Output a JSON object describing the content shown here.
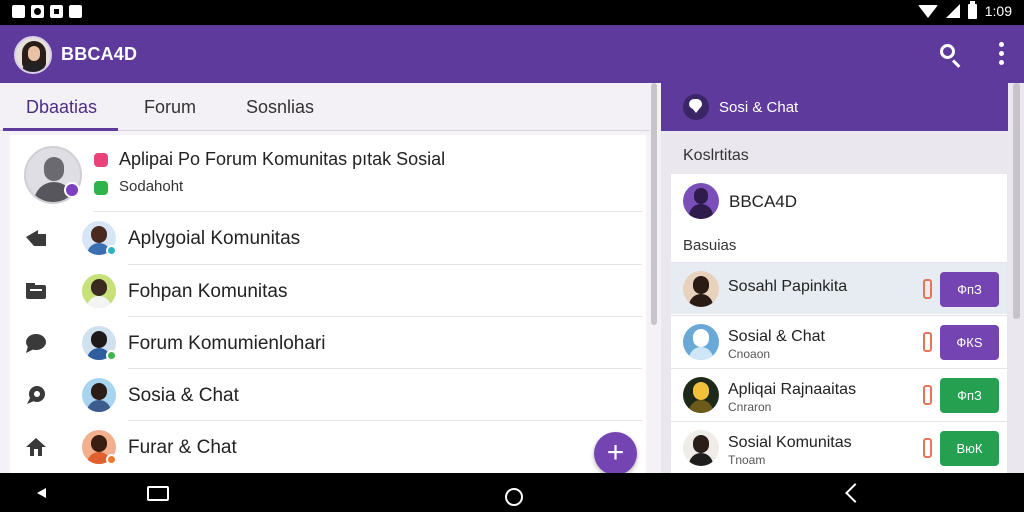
{
  "status_bar": {
    "time": "1:09"
  },
  "app_bar": {
    "title": "BBCA4D"
  },
  "tabs": [
    {
      "label": "Dbaatias",
      "active": true
    },
    {
      "label": "Forum",
      "active": false
    },
    {
      "label": "Sosnlias",
      "active": false
    }
  ],
  "main_list": {
    "top_item": {
      "title": "Aplipai Po Forum Komunitas pıtak Sosial",
      "subtitle": "Sodahoht"
    },
    "rows": [
      {
        "label": "Aplygoial Komunitas",
        "icon": "share-icon",
        "avatar_color": "#3b6fb0",
        "badge_color": "#2bb3c4"
      },
      {
        "label": "Fohpan Komunitas",
        "icon": "folder-icon",
        "avatar_color": "#9bc53d",
        "badge_color": ""
      },
      {
        "label": "Forum Komumienlohari",
        "icon": "chat-bubble-icon",
        "avatar_color": "#2f5d9e",
        "badge_color": "#3fb34f"
      },
      {
        "label": "Sosia & Chat",
        "icon": "comment-icon",
        "avatar_color": "#6fb0d8",
        "badge_color": ""
      },
      {
        "label": "Furar & Chat",
        "icon": "home-icon",
        "avatar_color": "#e0602f",
        "badge_color": "#ef7a2b"
      }
    ]
  },
  "right_panel": {
    "header_title": "Sosi & Chat",
    "section_label": "Koslrtitas",
    "user_name": "BBCA4D",
    "subsection_label": "Basuias",
    "rows": [
      {
        "name": "Sosahl Papinkita",
        "sub": "",
        "button": "ФпЗ",
        "button_color": "#7444b3",
        "avatar_color": "#e9d2bd",
        "selected": true
      },
      {
        "name": "Sosial & Chat",
        "sub": "Cnoaon",
        "button": "ФКЅ",
        "button_color": "#7444b3",
        "avatar_color": "#6aa8d6",
        "selected": false
      },
      {
        "name": "Apliqai Rajnaaitas",
        "sub": "Cnraron",
        "button": "ФпЗ",
        "button_color": "#24a050",
        "avatar_color": "#1d2a1a",
        "selected": false
      },
      {
        "name": "Sosial Komunitas",
        "sub": "Tnoam",
        "button": "ВюК",
        "button_color": "#24a050",
        "avatar_color": "#f0ece8",
        "selected": false
      }
    ]
  },
  "colors": {
    "primary": "#5d3a9b",
    "accent": "#7444b3",
    "success": "#24a050"
  }
}
